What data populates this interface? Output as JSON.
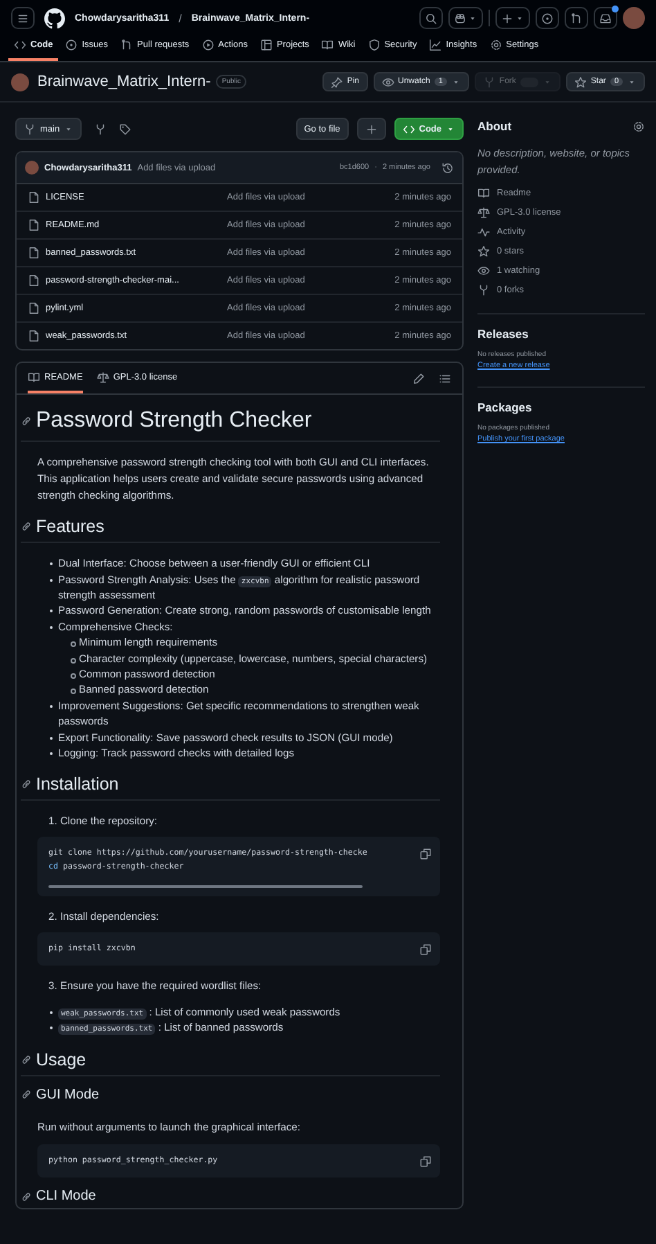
{
  "header": {
    "owner": "Chowdarysaritha311",
    "separator": "/",
    "repo": "Brainwave_Matrix_Intern-",
    "unread": true
  },
  "nav_tabs": [
    {
      "label": "Code",
      "selected": true
    },
    {
      "label": "Issues",
      "selected": false
    },
    {
      "label": "Pull requests",
      "selected": false
    },
    {
      "label": "Actions",
      "selected": false
    },
    {
      "label": "Projects",
      "selected": false
    },
    {
      "label": "Wiki",
      "selected": false
    },
    {
      "label": "Security",
      "selected": false
    },
    {
      "label": "Insights",
      "selected": false
    },
    {
      "label": "Settings",
      "selected": false
    }
  ],
  "repo": {
    "name": "Brainwave_Matrix_Intern-",
    "visibility": "Public",
    "pin": "Pin",
    "watch": {
      "label": "Unwatch",
      "count": "1"
    },
    "fork": {
      "label": "Fork",
      "disabled": true
    },
    "star": {
      "label": "Star",
      "count": "0"
    }
  },
  "toolbar": {
    "branch": "main",
    "go_to_file": "Go to file",
    "code": "Code"
  },
  "commit": {
    "author": "Chowdarysaritha311",
    "message": "Add files via upload",
    "hash": "bc1d600",
    "separator": "·",
    "time": "2 minutes ago"
  },
  "files": [
    {
      "name": "LICENSE",
      "message": "Add files via upload",
      "time": "2 minutes ago"
    },
    {
      "name": "README.md",
      "message": "Add files via upload",
      "time": "2 minutes ago"
    },
    {
      "name": "banned_passwords.txt",
      "message": "Add files via upload",
      "time": "2 minutes ago"
    },
    {
      "name": "password-strength-checker-mai...",
      "message": "Add files via upload",
      "time": "2 minutes ago"
    },
    {
      "name": "pylint.yml",
      "message": "Add files via upload",
      "time": "2 minutes ago"
    },
    {
      "name": "weak_passwords.txt",
      "message": "Add files via upload",
      "time": "2 minutes ago"
    }
  ],
  "readme_tabs": [
    {
      "label": "README",
      "selected": true
    },
    {
      "label": "GPL-3.0 license",
      "selected": false
    }
  ],
  "readme": [
    {
      "kind": "h1",
      "text": "Password Strength Checker"
    },
    {
      "kind": "p",
      "text": "A comprehensive password strength checking tool with both GUI and CLI interfaces. This application helps users create and validate secure passwords using advanced strength checking algorithms."
    },
    {
      "kind": "h2",
      "text": "Features"
    },
    {
      "kind": "ul",
      "items": [
        {
          "parts": [
            {
              "kind": "text",
              "text": "Dual Interface: Choose between a user-friendly GUI or efficient CLI"
            }
          ]
        },
        {
          "parts": [
            {
              "kind": "text",
              "text": "Password Strength Analysis: Uses the "
            },
            {
              "kind": "code",
              "text": "zxcvbn"
            },
            {
              "kind": "text",
              "text": " algorithm for realistic password strength assessment"
            }
          ]
        },
        {
          "parts": [
            {
              "kind": "text",
              "text": "Password Generation: Create strong, random passwords of customisable length"
            }
          ]
        },
        {
          "parts": [
            {
              "kind": "text",
              "text": "Comprehensive Checks:"
            }
          ],
          "children": [
            {
              "parts": [
                {
                  "kind": "text",
                  "text": "Minimum length requirements"
                }
              ]
            },
            {
              "parts": [
                {
                  "kind": "text",
                  "text": "Character complexity (uppercase, lowercase, numbers, special characters)"
                }
              ]
            },
            {
              "parts": [
                {
                  "kind": "text",
                  "text": "Common password detection"
                }
              ]
            },
            {
              "parts": [
                {
                  "kind": "text",
                  "text": "Banned password detection"
                }
              ]
            }
          ]
        },
        {
          "parts": [
            {
              "kind": "text",
              "text": "Improvement Suggestions: Get specific recommendations to strengthen weak passwords"
            }
          ]
        },
        {
          "parts": [
            {
              "kind": "text",
              "text": "Export Functionality: Save password check results to JSON (GUI mode)"
            }
          ]
        },
        {
          "parts": [
            {
              "kind": "text",
              "text": "Logging: Track password checks with detailed logs"
            }
          ]
        }
      ]
    },
    {
      "kind": "h2",
      "text": "Installation"
    },
    {
      "kind": "step",
      "text": "1. Clone the repository:"
    },
    {
      "kind": "code",
      "scroll": true,
      "lines": [
        [
          {
            "kind": "plain",
            "text": "git clone https://github.com/yourusername/password-strength-checke"
          }
        ],
        [
          {
            "kind": "keyword",
            "text": "cd"
          },
          {
            "kind": "plain",
            "text": " password-strength-checker"
          }
        ]
      ]
    },
    {
      "kind": "step",
      "text": "2. Install dependencies:"
    },
    {
      "kind": "code",
      "scroll": false,
      "lines": [
        [
          {
            "kind": "plain",
            "text": "pip install zxcvbn"
          }
        ]
      ]
    },
    {
      "kind": "step",
      "text": "3. Ensure you have the required wordlist files:"
    },
    {
      "kind": "ul",
      "items": [
        {
          "parts": [
            {
              "kind": "code",
              "text": "weak_passwords.txt"
            },
            {
              "kind": "text",
              "text": " : List of commonly used weak passwords"
            }
          ]
        },
        {
          "parts": [
            {
              "kind": "code",
              "text": "banned_passwords.txt"
            },
            {
              "kind": "text",
              "text": " : List of banned passwords"
            }
          ]
        }
      ]
    },
    {
      "kind": "h2",
      "text": "Usage"
    },
    {
      "kind": "h3",
      "text": "GUI Mode"
    },
    {
      "kind": "p",
      "text": "Run without arguments to launch the graphical interface:"
    },
    {
      "kind": "code",
      "scroll": false,
      "lines": [
        [
          {
            "kind": "plain",
            "text": "python password_strength_checker.py"
          }
        ]
      ]
    },
    {
      "kind": "h3",
      "text": "CLI Mode"
    }
  ],
  "sidebar": {
    "about": {
      "title": "About",
      "description": "No description, website, or topics provided.",
      "items": [
        "Readme",
        "GPL-3.0 license",
        "Activity",
        "0 stars",
        "1 watching",
        "0 forks"
      ]
    },
    "releases": {
      "title": "Releases",
      "note": "No releases published",
      "link": "Create a new release"
    },
    "packages": {
      "title": "Packages",
      "note": "No packages published",
      "link": "Publish your first package"
    }
  }
}
